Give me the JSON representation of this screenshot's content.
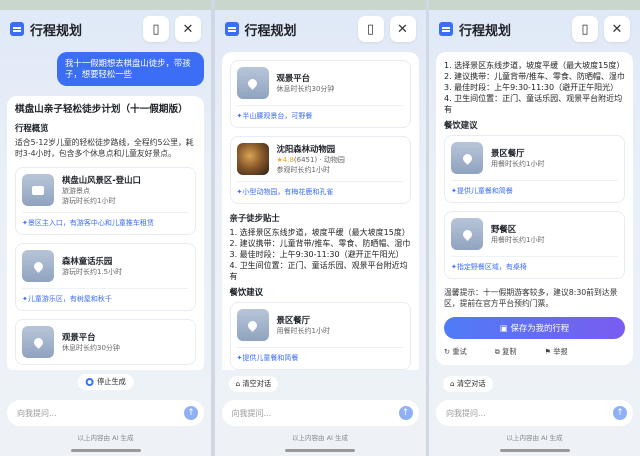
{
  "app": {
    "title": "行程规划",
    "close_icon": "✕",
    "note_icon": "▯"
  },
  "panel1": {
    "user_message": "我十一假期想去棋盘山徒步，带孩子，想要轻松一些",
    "plan_title": "棋盘山亲子轻松徒步计划（十一假期版）",
    "overview_heading": "行程概览",
    "overview_text": "适合5-12岁儿童的轻松徒步路线，全程约5公里，耗时3-4小时，包含多个休息点和儿童友好景点。",
    "pois": [
      {
        "name": "棋盘山风景区-登山口",
        "sub1": "旅游景点",
        "sub2": "游玩时长约1小时",
        "tip": "景区主入口，有游客中心和儿童推车租赁"
      },
      {
        "name": "森林童话乐园",
        "sub1": "游玩时长约1.5小时",
        "tip": "儿童游乐区，有树屋和秋千"
      },
      {
        "name": "观景平台",
        "sub1": "休息时长约30分钟"
      }
    ],
    "stop_label": "停止生成"
  },
  "panel2": {
    "pois": [
      {
        "name": "观景平台",
        "sub1": "休息时长约30分钟",
        "tip": "半山腰观景台，可野餐"
      },
      {
        "name": "沈阳森林动物园",
        "rating": "4.8",
        "reviews": "(6451)",
        "category": "动物园",
        "sub2": "参观时长约1小时",
        "tip": "小型动物园，有梅花鹿和孔雀"
      }
    ],
    "tips_heading": "亲子徒步贴士",
    "tips": [
      "1. 选择景区东线步道，坡度平缓（最大坡度15度）",
      "2. 建议携带：儿童背带/推车、零食、防晒帽、湿巾",
      "3. 最佳时段：上午9:30-11:30（避开正午阳光）",
      "4. 卫生间位置：正门、童话乐园、观景平台附近均有"
    ],
    "dining_heading": "餐饮建议",
    "dining": [
      {
        "name": "景区餐厅",
        "sub1": "用餐时长约1小时",
        "tip": "提供儿童餐和简餐"
      }
    ],
    "clear_label": "清空对话"
  },
  "panel3": {
    "tips": [
      "1. 选择景区东线步道，坡度平缓（最大坡度15度）",
      "2. 建议携带：儿童背带/推车、零食、防晒帽、湿巾",
      "3. 最佳时段：上午9:30-11:30（避开正午阳光）",
      "4. 卫生间位置：正门、童话乐园、观景平台附近均有"
    ],
    "dining_heading": "餐饮建议",
    "dining": [
      {
        "name": "景区餐厅",
        "sub1": "用餐时长约1小时",
        "tip": "提供儿童餐和简餐"
      },
      {
        "name": "野餐区",
        "sub1": "用餐时长约1小时",
        "tip": "指定野餐区域，有桌椅"
      }
    ],
    "warm_tip": "温馨提示：十一假期游客较多，建议8:30前到达景区，提前在官方平台预约门票。",
    "save_label": "保存为我的行程",
    "retry_label": "重试",
    "copy_label": "复制",
    "report_label": "举报",
    "clear_label": "清空对话"
  },
  "common": {
    "input_placeholder": "向我提问...",
    "footer": "以上内容由 AI 生成",
    "send_icon": "↑"
  }
}
